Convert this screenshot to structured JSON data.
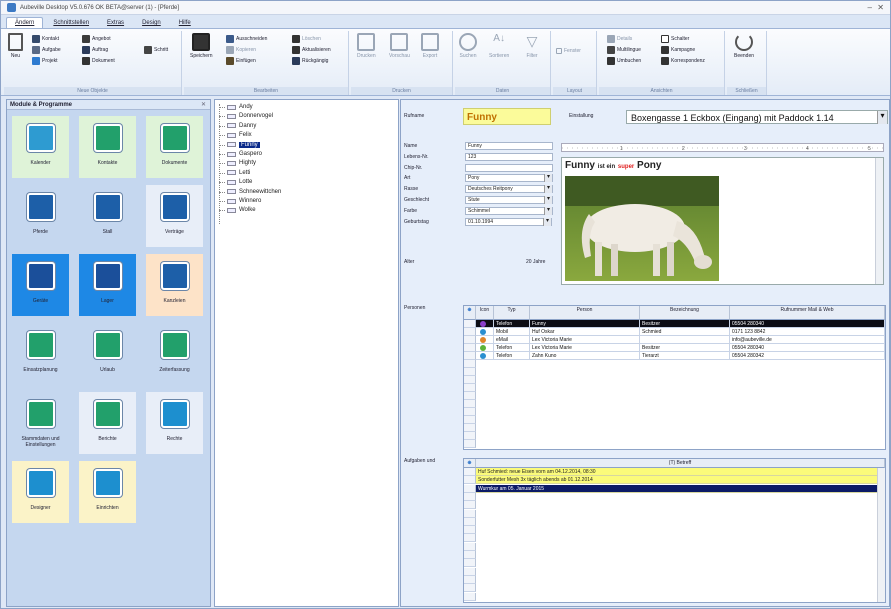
{
  "window": {
    "title": "Aubeville Desktop V5.0.676 OK BETA@server (1) - [Pferde]"
  },
  "menu_tabs": [
    "Ändern",
    "Schnittstellen",
    "Extras",
    "Design",
    "Hilfe"
  ],
  "ribbon": {
    "neue_objekte": {
      "label": "Neue Objekte",
      "neu": "Neu",
      "items": [
        "Kontakt",
        "Angebot",
        "Aufgabe",
        "Auftrag",
        "Projekt",
        "Dokument",
        "Schritt"
      ]
    },
    "bearbeiten": {
      "label": "Bearbeiten",
      "speichern": "Speichern",
      "items": [
        "Ausschneiden",
        "Kopieren",
        "Einfügen",
        "Löschen",
        "Aktualisieren",
        "Rückgängig"
      ]
    },
    "drucken": {
      "label": "Drucken",
      "items": [
        "Drucken",
        "Vorschau",
        "Export"
      ]
    },
    "daten": {
      "label": "Daten",
      "items": [
        "Suchen",
        "Sortieren",
        "Filter"
      ]
    },
    "layout": {
      "label": "Layout",
      "items": [
        "Fenster"
      ]
    },
    "ansichten": {
      "label": "Ansichten",
      "items": [
        "Details",
        "Schalter",
        "Multilingue",
        "Kampagne",
        "Umbuchen",
        "Korrespondenz"
      ]
    },
    "schliessen": {
      "label": "Schließen",
      "beenden": "Beenden"
    }
  },
  "left_panel": {
    "title": "Module & Programme",
    "tiles": [
      {
        "label": "Kalender",
        "icon": "calendar-icon",
        "color": "#2e9bd1",
        "bg": "#dff3d8"
      },
      {
        "label": "Kontakte",
        "icon": "contacts-icon",
        "color": "#22a06b",
        "bg": "#dff3d8"
      },
      {
        "label": "Dokumente",
        "icon": "documents-icon",
        "color": "#22a06b",
        "bg": "#dff3d8"
      },
      {
        "label": "Pferde",
        "icon": "horse-icon",
        "color": "#1d5fa8",
        "bg": "#c5d7ef"
      },
      {
        "label": "Stall",
        "icon": "stable-icon",
        "color": "#1d5fa8",
        "bg": "#c5d7ef"
      },
      {
        "label": "Verträge",
        "icon": "contract-icon",
        "color": "#1d5fa8",
        "bg": "#e8eef8"
      },
      {
        "label": "Geräte",
        "icon": "tractor-icon",
        "color": "#1b4f9a",
        "bg": "#1e88e5"
      },
      {
        "label": "Lager",
        "icon": "forklift-icon",
        "color": "#1b4f9a",
        "bg": "#1e88e5"
      },
      {
        "label": "Kanzleien",
        "icon": "scales-icon",
        "color": "#1d5fa8",
        "bg": "#fde3c8"
      },
      {
        "label": "Einsatzplanung",
        "icon": "planning-icon",
        "color": "#22a06b",
        "bg": "#c5d7ef"
      },
      {
        "label": "Urlaub",
        "icon": "vacation-icon",
        "color": "#22a06b",
        "bg": "#c5d7ef"
      },
      {
        "label": "Zeiterfassung",
        "icon": "stopwatch-icon",
        "color": "#22a06b",
        "bg": "#c5d7ef"
      },
      {
        "label": "Stammdaten und Einstellungen",
        "icon": "masterdata-icon",
        "color": "#22a06b",
        "bg": "#c5d7ef"
      },
      {
        "label": "Berichte",
        "icon": "reports-icon",
        "color": "#22a06b",
        "bg": "#e8eef8"
      },
      {
        "label": "Rechte",
        "icon": "key-icon",
        "color": "#1d8fcf",
        "bg": "#e8eef8"
      },
      {
        "label": "Designer",
        "icon": "designer-icon",
        "color": "#1d8fcf",
        "bg": "#fbf3c8"
      },
      {
        "label": "Einrichten",
        "icon": "setup-icon",
        "color": "#1d8fcf",
        "bg": "#fbf3c8"
      }
    ]
  },
  "tree": {
    "items": [
      "Andy",
      "Donnervogel",
      "Danny",
      "Felix",
      "Funny",
      "Gaspero",
      "Highty",
      "Letti",
      "Lotte",
      "Schneewittchen",
      "Winnero",
      "Wolke"
    ],
    "selected": "Funny"
  },
  "detail": {
    "rufname_label": "Rufname",
    "rufname": "Funny",
    "einstallung_label": "Einstallung",
    "einstallung": "Boxengasse 1 Eckbox (Eingang) mit Paddock 1.14",
    "fields": [
      {
        "label": "Name",
        "value": "Funny",
        "type": "text"
      },
      {
        "label": "Lebens-Nr.",
        "value": "123",
        "type": "text"
      },
      {
        "label": "Chip-Nr.",
        "value": "",
        "type": "text"
      },
      {
        "label": "Art",
        "value": "Pony",
        "type": "select"
      },
      {
        "label": "Rasse",
        "value": "Deutsches Reitpony",
        "type": "select"
      },
      {
        "label": "Geschlecht",
        "value": "Stute",
        "type": "select"
      },
      {
        "label": "Farbe",
        "value": "Schimmel",
        "type": "select"
      },
      {
        "label": "Geburtstag",
        "value": "01.10.1994",
        "type": "date"
      }
    ],
    "alter_label": "Alter",
    "alter": "20 Jahre",
    "note": {
      "w1": "Funny",
      "w2": "ist ein",
      "w3": "super",
      "w4": "Pony"
    },
    "personen_label": "Personen",
    "personen": {
      "columns": [
        "Icon",
        "Typ",
        "Person",
        "Bezeichnung",
        "Rufnummer Mail & Web"
      ],
      "rows": [
        {
          "typ": "Telefon",
          "person": "Funny",
          "bezeichnung": "Besitzer",
          "nummer": "05504 280340",
          "dot": "#8a3fc9"
        },
        {
          "typ": "Mobil",
          "person": "Huf Oskar",
          "bezeichnung": "Schmied",
          "nummer": "0171 123 8842",
          "dot": "#2b8fd0"
        },
        {
          "typ": "eMail",
          "person": "Lex Victoria Marie",
          "bezeichnung": "",
          "nummer": "info@aubeville.de",
          "dot": "#e0852a"
        },
        {
          "typ": "Telefon",
          "person": "Lex Victoria Marie",
          "bezeichnung": "Besitzer",
          "nummer": "05504 280340",
          "dot": "#5bb33a"
        },
        {
          "typ": "Telefon",
          "person": "Zahn Kuno",
          "bezeichnung": "Tierarzt",
          "nummer": "05504 280342",
          "dot": "#2b8fd0"
        }
      ]
    },
    "aufgaben_label": "Aufgaben und",
    "aufgaben": {
      "column": "(T) Betreff",
      "rows": [
        {
          "text": "Huf Schmied: neue Eisen vorn am 04.12.2014, 08:30",
          "style": "yellow"
        },
        {
          "text": "Sonderfutter Mesh 3x täglich abends ab 01.12.2014",
          "style": "yellow"
        },
        {
          "text": "Wurmkur am 05. Januar 2015",
          "style": "navy"
        }
      ]
    }
  }
}
